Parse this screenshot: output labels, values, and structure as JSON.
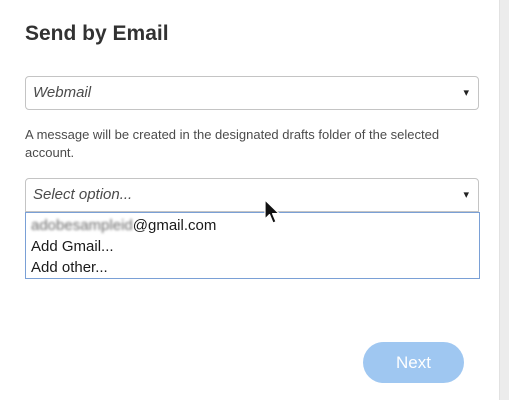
{
  "dialog": {
    "title": "Send by Email"
  },
  "provider_select": {
    "value": "Webmail",
    "arrow": "▾"
  },
  "hint_text": "A message will be created in the designated drafts folder of the selected account.",
  "account_select": {
    "placeholder": "Select option...",
    "arrow": "▾",
    "options": {
      "existing_account_user": "adobesampleid",
      "existing_account_domain": "@gmail.com",
      "add_gmail": "Add Gmail...",
      "add_other": "Add other..."
    }
  },
  "footer": {
    "next_label": "Next"
  },
  "colors": {
    "next_button": "#9fc7f1",
    "listbox_border": "#7aa0d6",
    "title": "#323232"
  },
  "icons": {
    "dropdown": "chevron-down-icon",
    "pointer": "mouse-cursor-icon"
  }
}
